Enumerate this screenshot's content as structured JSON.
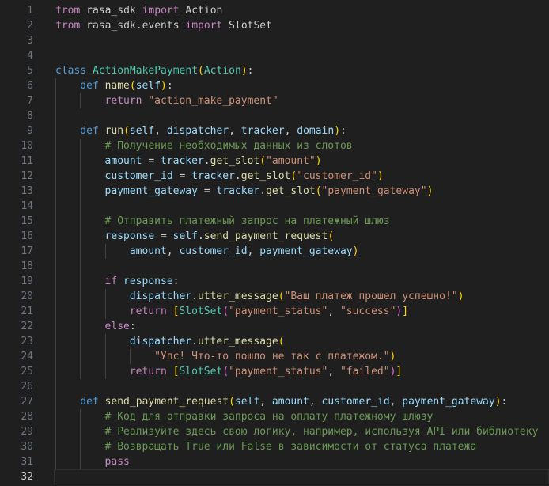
{
  "editor": {
    "language": "python",
    "current_line": 32,
    "lines": [
      {
        "n": "1",
        "indent": 0,
        "tokens": [
          [
            "from",
            "kw"
          ],
          [
            " rasa_sdk ",
            "plain"
          ],
          [
            "import",
            "kw"
          ],
          [
            " Action",
            "plain"
          ]
        ]
      },
      {
        "n": "2",
        "indent": 0,
        "tokens": [
          [
            "from",
            "kw"
          ],
          [
            " rasa_sdk.events ",
            "plain"
          ],
          [
            "import",
            "kw"
          ],
          [
            " SlotSet",
            "plain"
          ]
        ]
      },
      {
        "n": "3",
        "indent": 0,
        "tokens": []
      },
      {
        "n": "4",
        "indent": 0,
        "tokens": []
      },
      {
        "n": "5",
        "indent": 0,
        "tokens": [
          [
            "class",
            "def"
          ],
          [
            " ",
            "plain"
          ],
          [
            "ActionMakePayment",
            "cls"
          ],
          [
            "(",
            "p1"
          ],
          [
            "Action",
            "cls"
          ],
          [
            ")",
            "p1"
          ],
          [
            ":",
            "plain"
          ]
        ]
      },
      {
        "n": "6",
        "indent": 1,
        "tokens": [
          [
            "def",
            "def"
          ],
          [
            " ",
            "plain"
          ],
          [
            "name",
            "fn"
          ],
          [
            "(",
            "p1"
          ],
          [
            "self",
            "var"
          ],
          [
            ")",
            "p1"
          ],
          [
            ":",
            "plain"
          ]
        ]
      },
      {
        "n": "7",
        "indent": 2,
        "tokens": [
          [
            "return",
            "kw"
          ],
          [
            " ",
            "plain"
          ],
          [
            "\"action_make_payment\"",
            "str"
          ]
        ]
      },
      {
        "n": "8",
        "indent": 1,
        "tokens": []
      },
      {
        "n": "9",
        "indent": 1,
        "tokens": [
          [
            "def",
            "def"
          ],
          [
            " ",
            "plain"
          ],
          [
            "run",
            "fn"
          ],
          [
            "(",
            "p1"
          ],
          [
            "self",
            "var"
          ],
          [
            ", ",
            "plain"
          ],
          [
            "dispatcher",
            "var"
          ],
          [
            ", ",
            "plain"
          ],
          [
            "tracker",
            "var"
          ],
          [
            ", ",
            "plain"
          ],
          [
            "domain",
            "var"
          ],
          [
            ")",
            "p1"
          ],
          [
            ":",
            "plain"
          ]
        ]
      },
      {
        "n": "10",
        "indent": 2,
        "tokens": [
          [
            "# Получение необходимых данных из слотов",
            "cmt"
          ]
        ]
      },
      {
        "n": "11",
        "indent": 2,
        "tokens": [
          [
            "amount",
            "var"
          ],
          [
            " = ",
            "plain"
          ],
          [
            "tracker",
            "var"
          ],
          [
            ".",
            "plain"
          ],
          [
            "get_slot",
            "fn"
          ],
          [
            "(",
            "p1"
          ],
          [
            "\"amount\"",
            "str"
          ],
          [
            ")",
            "p1"
          ]
        ]
      },
      {
        "n": "12",
        "indent": 2,
        "tokens": [
          [
            "customer_id",
            "var"
          ],
          [
            " = ",
            "plain"
          ],
          [
            "tracker",
            "var"
          ],
          [
            ".",
            "plain"
          ],
          [
            "get_slot",
            "fn"
          ],
          [
            "(",
            "p1"
          ],
          [
            "\"customer_id\"",
            "str"
          ],
          [
            ")",
            "p1"
          ]
        ]
      },
      {
        "n": "13",
        "indent": 2,
        "tokens": [
          [
            "payment_gateway",
            "var"
          ],
          [
            " = ",
            "plain"
          ],
          [
            "tracker",
            "var"
          ],
          [
            ".",
            "plain"
          ],
          [
            "get_slot",
            "fn"
          ],
          [
            "(",
            "p1"
          ],
          [
            "\"payment_gateway\"",
            "str"
          ],
          [
            ")",
            "p1"
          ]
        ]
      },
      {
        "n": "14",
        "indent": 2,
        "tokens": []
      },
      {
        "n": "15",
        "indent": 2,
        "tokens": [
          [
            "# Отправить платежный запрос на платежный шлюз",
            "cmt"
          ]
        ]
      },
      {
        "n": "16",
        "indent": 2,
        "tokens": [
          [
            "response",
            "var"
          ],
          [
            " = ",
            "plain"
          ],
          [
            "self",
            "var"
          ],
          [
            ".",
            "plain"
          ],
          [
            "send_payment_request",
            "fn"
          ],
          [
            "(",
            "p1"
          ]
        ]
      },
      {
        "n": "17",
        "indent": 3,
        "tokens": [
          [
            "amount",
            "var"
          ],
          [
            ", ",
            "plain"
          ],
          [
            "customer_id",
            "var"
          ],
          [
            ", ",
            "plain"
          ],
          [
            "payment_gateway",
            "var"
          ],
          [
            ")",
            "p1"
          ]
        ]
      },
      {
        "n": "18",
        "indent": 2,
        "tokens": []
      },
      {
        "n": "19",
        "indent": 2,
        "tokens": [
          [
            "if",
            "kw"
          ],
          [
            " ",
            "plain"
          ],
          [
            "response",
            "var"
          ],
          [
            ":",
            "plain"
          ]
        ]
      },
      {
        "n": "20",
        "indent": 3,
        "tokens": [
          [
            "dispatcher",
            "var"
          ],
          [
            ".",
            "plain"
          ],
          [
            "utter_message",
            "fn"
          ],
          [
            "(",
            "p1"
          ],
          [
            "\"Ваш платеж прошел успешно!\"",
            "str"
          ],
          [
            ")",
            "p1"
          ]
        ]
      },
      {
        "n": "21",
        "indent": 3,
        "tokens": [
          [
            "return",
            "kw"
          ],
          [
            " ",
            "plain"
          ],
          [
            "[",
            "p1"
          ],
          [
            "SlotSet",
            "cls"
          ],
          [
            "(",
            "p2"
          ],
          [
            "\"payment_status\"",
            "str"
          ],
          [
            ", ",
            "plain"
          ],
          [
            "\"success\"",
            "str"
          ],
          [
            ")",
            "p2"
          ],
          [
            "]",
            "p1"
          ]
        ]
      },
      {
        "n": "22",
        "indent": 2,
        "tokens": [
          [
            "else",
            "kw"
          ],
          [
            ":",
            "plain"
          ]
        ]
      },
      {
        "n": "23",
        "indent": 3,
        "tokens": [
          [
            "dispatcher",
            "var"
          ],
          [
            ".",
            "plain"
          ],
          [
            "utter_message",
            "fn"
          ],
          [
            "(",
            "p1"
          ]
        ]
      },
      {
        "n": "24",
        "indent": 4,
        "tokens": [
          [
            "\"Упс! Что-то пошло не так с платежом.\"",
            "str"
          ],
          [
            ")",
            "p1"
          ]
        ]
      },
      {
        "n": "25",
        "indent": 3,
        "tokens": [
          [
            "return",
            "kw"
          ],
          [
            " ",
            "plain"
          ],
          [
            "[",
            "p1"
          ],
          [
            "SlotSet",
            "cls"
          ],
          [
            "(",
            "p2"
          ],
          [
            "\"payment_status\"",
            "str"
          ],
          [
            ", ",
            "plain"
          ],
          [
            "\"failed\"",
            "str"
          ],
          [
            ")",
            "p2"
          ],
          [
            "]",
            "p1"
          ]
        ]
      },
      {
        "n": "26",
        "indent": 1,
        "tokens": []
      },
      {
        "n": "27",
        "indent": 1,
        "tokens": [
          [
            "def",
            "def"
          ],
          [
            " ",
            "plain"
          ],
          [
            "send_payment_request",
            "fn"
          ],
          [
            "(",
            "p1"
          ],
          [
            "self",
            "var"
          ],
          [
            ", ",
            "plain"
          ],
          [
            "amount",
            "var"
          ],
          [
            ", ",
            "plain"
          ],
          [
            "customer_id",
            "var"
          ],
          [
            ", ",
            "plain"
          ],
          [
            "payment_gateway",
            "var"
          ],
          [
            ")",
            "p1"
          ],
          [
            ":",
            "plain"
          ]
        ]
      },
      {
        "n": "28",
        "indent": 2,
        "tokens": [
          [
            "# Код для отправки запроса на оплату платежному шлюзу",
            "cmt"
          ]
        ]
      },
      {
        "n": "29",
        "indent": 2,
        "tokens": [
          [
            "# Реализуйте здесь свою логику, например, используя API или библиотеку",
            "cmt"
          ]
        ]
      },
      {
        "n": "30",
        "indent": 2,
        "tokens": [
          [
            "# Возвращать True или False в зависимости от статуса платежа",
            "cmt"
          ]
        ]
      },
      {
        "n": "31",
        "indent": 2,
        "tokens": [
          [
            "pass",
            "kw"
          ]
        ]
      },
      {
        "n": "32",
        "indent": 0,
        "tokens": []
      }
    ]
  }
}
